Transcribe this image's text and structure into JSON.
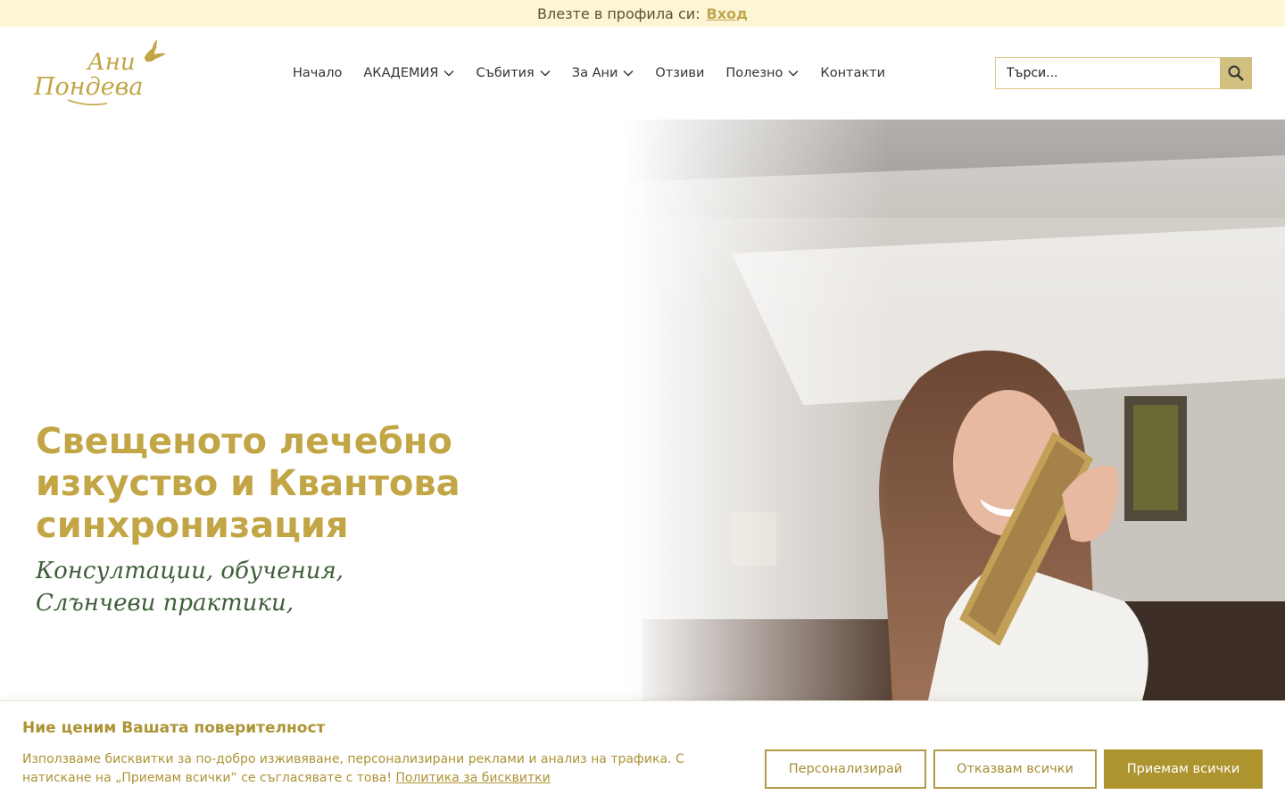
{
  "topbar": {
    "prompt": "Влезте в профила си:",
    "login": "Вход"
  },
  "header": {
    "logo": {
      "line1": "Ани",
      "line2": "Пондева"
    },
    "nav": [
      {
        "label": "Начало",
        "dropdown": false
      },
      {
        "label": "АКАДЕМИЯ",
        "dropdown": true
      },
      {
        "label": "Събития",
        "dropdown": true
      },
      {
        "label": "За Ани",
        "dropdown": true
      },
      {
        "label": "Отзиви",
        "dropdown": false
      },
      {
        "label": "Полезно",
        "dropdown": true
      },
      {
        "label": "Контакти",
        "dropdown": false
      }
    ],
    "search": {
      "placeholder": "Търси...",
      "icon": "search-icon"
    }
  },
  "hero": {
    "title": "Свещеното лечебно изкуство и Квантова синхронизация",
    "subtitle_line1": "Консултации, обучения,",
    "subtitle_line2": "Слънчеви практики,"
  },
  "cookie": {
    "title": "Ние ценим Вашата поверителност",
    "text": "Използваме бисквитки за по-добро изживяване, персонализирани реклами и анализ на трафика. С натискане на „Приемам всички“ се съгласявате с това!",
    "policy_link": "Политика за бисквитки",
    "buttons": {
      "customize": "Персонализирай",
      "reject": "Отказвам всички",
      "accept": "Приемам всички"
    }
  },
  "colors": {
    "gold": "#c2a545",
    "dark_gold": "#ae942f",
    "green": "#3f5e3a",
    "topbar_bg": "#fdf6d6"
  }
}
